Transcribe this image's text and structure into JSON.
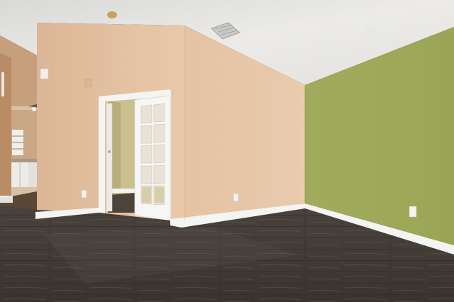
{
  "scene": {
    "subject": "empty-room-interior",
    "colors": {
      "ceiling": "#ecebe8",
      "beige_wall": "#e7c7a8",
      "beige_wall_shadow": "#d7b596",
      "green_wall": "#a3ae5c",
      "green_wall_shadow": "#97a254",
      "floor_dark": "#3b3632",
      "floor_light": "#5b534c",
      "trim_white": "#f4f4f2",
      "next_room_wall": "#c9c08e"
    }
  }
}
